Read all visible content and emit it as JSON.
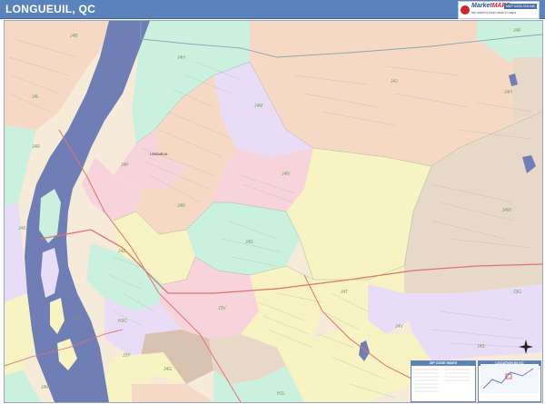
{
  "header": {
    "title": "LONGUEUIL, QC"
  },
  "logo": {
    "line1": "Market",
    "line2": "MAPS",
    "tagline": "the nation's best value in maps",
    "badge": "MAP DATA ONLINE"
  },
  "map": {
    "place_label": "LONGUEUIL",
    "zone_labels": [
      "J4B",
      "J4H",
      "J4J",
      "J4K",
      "J4L",
      "J4M",
      "J4N",
      "J4P",
      "J4R",
      "J4S",
      "J4T",
      "J4V",
      "J4W",
      "J4X",
      "J4Y",
      "J4Z",
      "J3Y",
      "J3V",
      "J4G",
      "H2L",
      "H3C",
      "H1X",
      "J3G",
      "J4K",
      "J4H",
      "J4R",
      "J4S"
    ],
    "colors": {
      "water": "#6f7fb6",
      "land_outside": "#fbfbf4",
      "highway": "#e37171",
      "boundary": "#7aa27a"
    }
  },
  "index_panel": {
    "title": "ZIP CODE INDEX"
  },
  "inset_panel": {
    "title": "LOCATION IN QC"
  },
  "compass": {
    "name": "north-arrow-icon"
  }
}
